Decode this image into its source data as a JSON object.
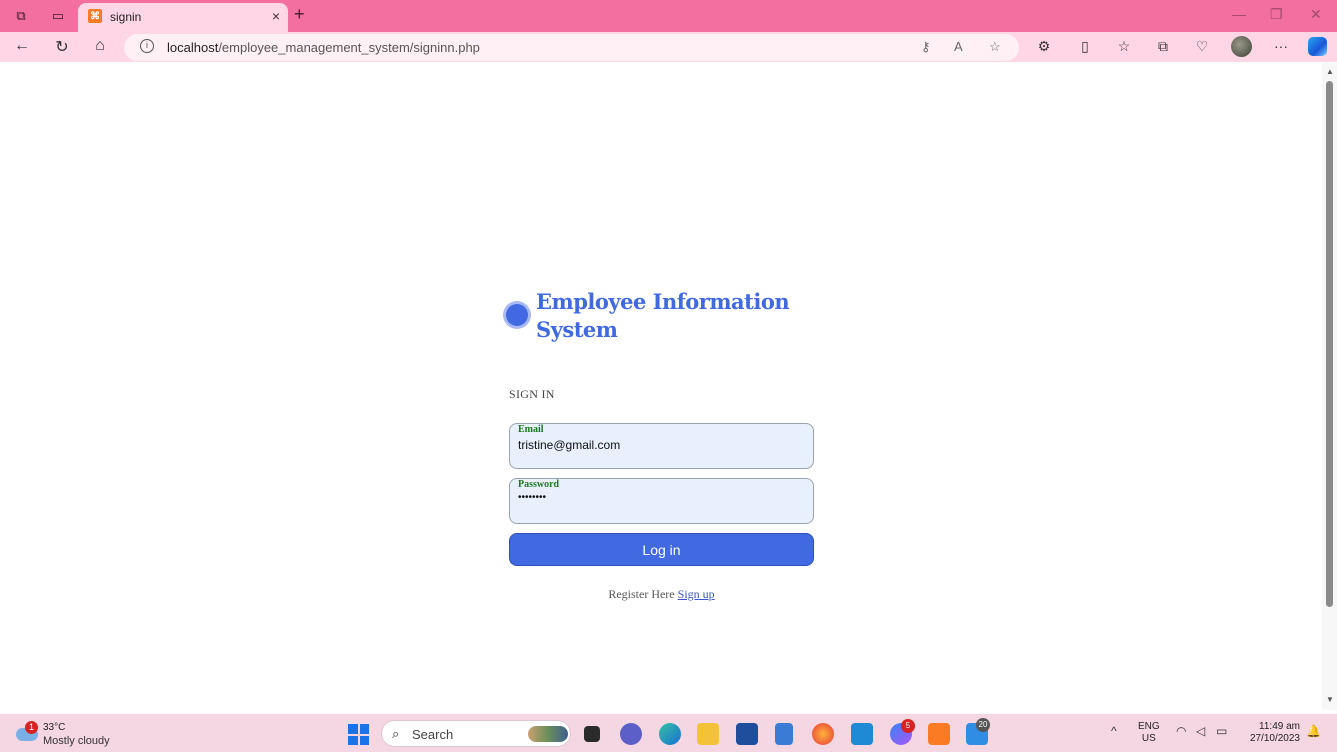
{
  "browser": {
    "tab_title": "signin",
    "tab_close": "×",
    "new_tab": "+",
    "url_host": "localhost",
    "url_path": "/employee_management_system/signinn.php",
    "more_menu": "···"
  },
  "page": {
    "brand_name": "Employee Information System",
    "heading": "SIGN IN",
    "email_label": "Email",
    "email_value": "tristine@gmail.com",
    "password_label": "Password",
    "password_value": "••••••••",
    "login_button": "Log in",
    "register_text": "Register Here",
    "signup_link": "Sign up"
  },
  "taskbar": {
    "weather_temp": "33°C",
    "weather_condition": "Mostly cloudy",
    "weather_badge": "1",
    "search_placeholder": "Search",
    "messenger_badge": "5",
    "mail_badge": "20",
    "lang_primary": "ENG",
    "lang_secondary": "US",
    "time": "11:49 am",
    "date": "27/10/2023"
  },
  "colors": {
    "accent": "#4169e1",
    "tab_bar": "#f36fa0",
    "toolbar": "#ffd6e6",
    "taskbar": "#f5d7e3",
    "label_green": "#1f7a1f"
  }
}
